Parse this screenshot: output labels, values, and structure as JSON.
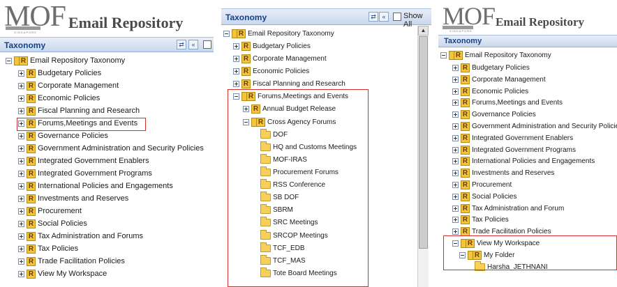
{
  "panel1": {
    "logo": {
      "mof": "MOF",
      "title": "Email Repository",
      "subtitle": "SINGAPORE"
    },
    "header": {
      "title": "Taxonomy",
      "refresh_icon": "refresh-icon",
      "collapse_icon": "double-chevron-left-icon"
    },
    "tree": {
      "root": "Email Repository Taxonomy",
      "items": [
        "Budgetary Policies",
        "Corporate Management",
        "Economic Policies",
        "Fiscal Planning and Research",
        "Forums,Meetings and Events",
        "Governance Policies",
        "Government Administration and Security Policies",
        "Integrated Government Enablers",
        "Integrated Government Programs",
        "International Policies and Engagements",
        "Investments and Reserves",
        "Procurement",
        "Social Policies",
        "Tax Administration and Forums",
        "Tax Policies",
        "Trade Facilitation Policies",
        "View My Workspace"
      ]
    }
  },
  "panel2": {
    "header": {
      "title": "Taxonomy",
      "show_all": "Show All"
    },
    "tree": {
      "root": "Email Repository Taxonomy",
      "items": [
        "Budgetary Policies",
        "Corporate Management",
        "Economic Policies",
        "Fiscal Planning and Research"
      ],
      "expanded": "Forums,Meetings and Events",
      "children": [
        "Annual Budget Release"
      ],
      "sub_expanded": "Cross Agency Forums",
      "folders": [
        "DOF",
        "HQ and Customs Meetings",
        "MOF-IRAS",
        "Procurement Forums",
        "RSS Conference",
        "SB DOF",
        "SBRM",
        "SRC Meetings",
        "SRCOP Meetings",
        "TCF_EDB",
        "TCF_MAS",
        "Tote Board Meetings"
      ]
    }
  },
  "panel3": {
    "logo": {
      "mof": "MOF",
      "title": "Email Repository",
      "subtitle": "SINGAPORE"
    },
    "header": {
      "title": "Taxonomy"
    },
    "tree": {
      "root": "Email Repository Taxonomy",
      "items": [
        "Budgetary Policies",
        "Corporate Management",
        "Economic Policies",
        "Forums,Meetings and Events",
        "Governance Policies",
        "Government Administration and Security Policies",
        "Integrated Government Enablers",
        "Integrated Government Programs",
        "International Policies and Engagements",
        "Investments and Reserves",
        "Procurement",
        "Social Policies",
        "Tax Administration and Forum",
        "Tax Policies",
        "Trade Facilitation Policies"
      ],
      "expanded": "View My Workspace",
      "sub_expanded": "My Folder",
      "folder": "Harsha_JETHNANI"
    }
  },
  "colors": {
    "header_text": "#15428b",
    "highlight_box": "#d32f2f",
    "node_icon": "#f3c53f"
  }
}
